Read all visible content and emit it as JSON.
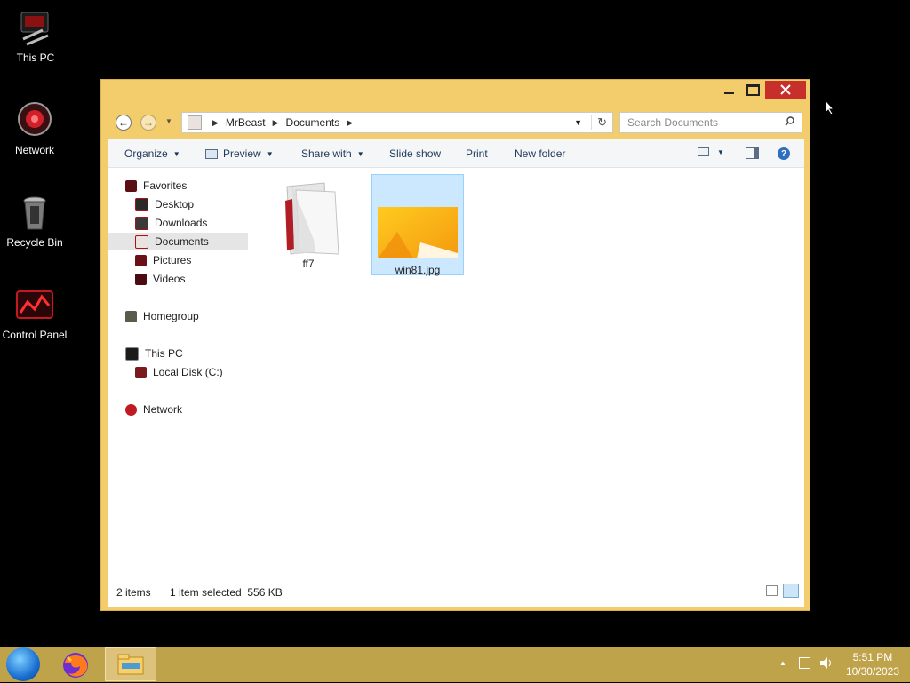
{
  "desktop": {
    "icons": [
      {
        "label": "This PC",
        "icon": "this-pc-icon"
      },
      {
        "label": "Network",
        "icon": "network-icon"
      },
      {
        "label": "Recycle Bin",
        "icon": "recycle-bin-icon"
      },
      {
        "label": "Control Panel",
        "icon": "control-panel-icon"
      }
    ]
  },
  "window": {
    "address": {
      "parts": [
        "MrBeast",
        "Documents"
      ]
    },
    "search_placeholder": "Search Documents",
    "toolbar": {
      "organize": "Organize",
      "preview": "Preview",
      "share_with": "Share with",
      "slide_show": "Slide show",
      "print": "Print",
      "new_folder": "New folder"
    },
    "nav": {
      "favorites": "Favorites",
      "favorites_items": [
        "Desktop",
        "Downloads",
        "Documents",
        "Pictures",
        "Videos"
      ],
      "homegroup": "Homegroup",
      "this_pc": "This PC",
      "local_disk": "Local Disk (C:)",
      "network": "Network"
    },
    "files": [
      {
        "name": "ff7",
        "type": "folder"
      },
      {
        "name": "win81.jpg",
        "type": "image",
        "selected": true
      }
    ],
    "status": {
      "count": "2 items",
      "selection": "1 item selected  556 KB"
    }
  },
  "taskbar": {
    "time": "5:51 PM",
    "date": "10/30/2023"
  },
  "colors": {
    "window_frame": "#f3cd6c",
    "taskbar": "#bfa34b",
    "close_button": "#c7302a",
    "selection": "#cce8ff"
  }
}
